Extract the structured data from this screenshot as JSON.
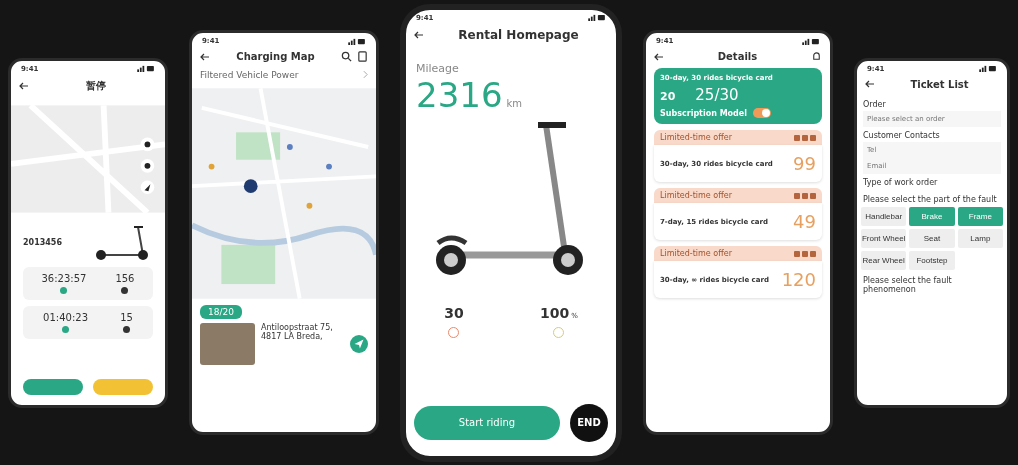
{
  "pause_screen": {
    "time": "9:41",
    "title": "暂停",
    "scooter_id": "2013456",
    "stats": [
      {
        "value": "36:23:57",
        "color": "#2aa784"
      },
      {
        "value": "156",
        "color": "#333333"
      },
      {
        "value": "01:40:23",
        "color": "#2aa784"
      },
      {
        "value": "15",
        "color": "#333333"
      }
    ]
  },
  "charging_map": {
    "time": "9:41",
    "title": "Charging Map",
    "filter": "Filtered Vehicle Power",
    "badge": "18/20",
    "address": "Antiloopstraat 75, 4817 LA Breda,"
  },
  "rental_home": {
    "time": "9:41",
    "title": "Rental Homepage",
    "mileage_label": "Mileage",
    "mileage": "2316",
    "unit": "km",
    "days": "30",
    "power": "100",
    "power_unit": "%",
    "start_button": "Start riding",
    "end_button": "END"
  },
  "details": {
    "time": "9:41",
    "title": "Details",
    "card_title": "30-day, 30 rides bicycle card",
    "days_left": "20",
    "rides": "25/30",
    "subscription_label": "Subscription Model",
    "subscription_on": true,
    "offers": [
      {
        "tag": "Limited-time offer",
        "name": "30-day, 30 rides bicycle card",
        "price": "99"
      },
      {
        "tag": "Limited-time offer",
        "name": "7-day, 15 rides bicycle card",
        "price": "49"
      },
      {
        "tag": "Limited-time offer",
        "name": "30-day, ∞ rides bicycle card",
        "price": "120"
      }
    ]
  },
  "ticket_list": {
    "time": "9:41",
    "title": "Ticket List",
    "order_label": "Order",
    "order_placeholder": "Please select an order",
    "contacts_label": "Customer Contacts",
    "tel_placeholder": "Tel",
    "email_placeholder": "Email",
    "type_label": "Type of work order",
    "part_prompt": "Please select the part of the fault",
    "parts": [
      {
        "label": "Handlebar",
        "selected": false
      },
      {
        "label": "Brake",
        "selected": true
      },
      {
        "label": "Frame",
        "selected": true
      },
      {
        "label": "Front Wheel",
        "selected": false
      },
      {
        "label": "Seat",
        "selected": false
      },
      {
        "label": "Lamp",
        "selected": false
      },
      {
        "label": "Rear Wheel",
        "selected": false
      },
      {
        "label": "Footstep",
        "selected": false
      }
    ],
    "phenomenon_prompt": "Please select the fault phenomenon"
  }
}
